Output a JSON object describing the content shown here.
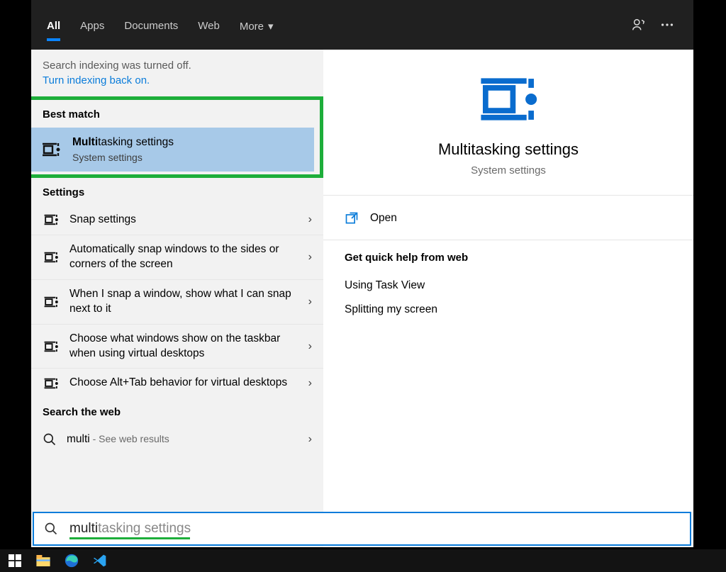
{
  "header": {
    "tabs": [
      "All",
      "Apps",
      "Documents",
      "Web",
      "More"
    ],
    "active_index": 0
  },
  "left": {
    "notice": "Search indexing was turned off.",
    "notice_link": "Turn indexing back on.",
    "best_match_label": "Best match",
    "best_match": {
      "title_bold": "Multi",
      "title_rest": "tasking settings",
      "subtitle": "System settings"
    },
    "settings_label": "Settings",
    "settings": [
      "Snap settings",
      "Automatically snap windows to the sides or corners of the screen",
      "When I snap a window, show what I can snap next to it",
      "Choose what windows show on the taskbar when using virtual desktops",
      "Choose Alt+Tab behavior for virtual desktops"
    ],
    "web_label": "Search the web",
    "web_query": "multi",
    "web_suffix": " - See web results"
  },
  "right": {
    "title": "Multitasking settings",
    "subtitle": "System settings",
    "open": "Open",
    "help_label": "Get quick help from web",
    "help_links": [
      "Using Task View",
      "Splitting my screen"
    ]
  },
  "search": {
    "typed": "multi",
    "ghost": "tasking settings"
  }
}
